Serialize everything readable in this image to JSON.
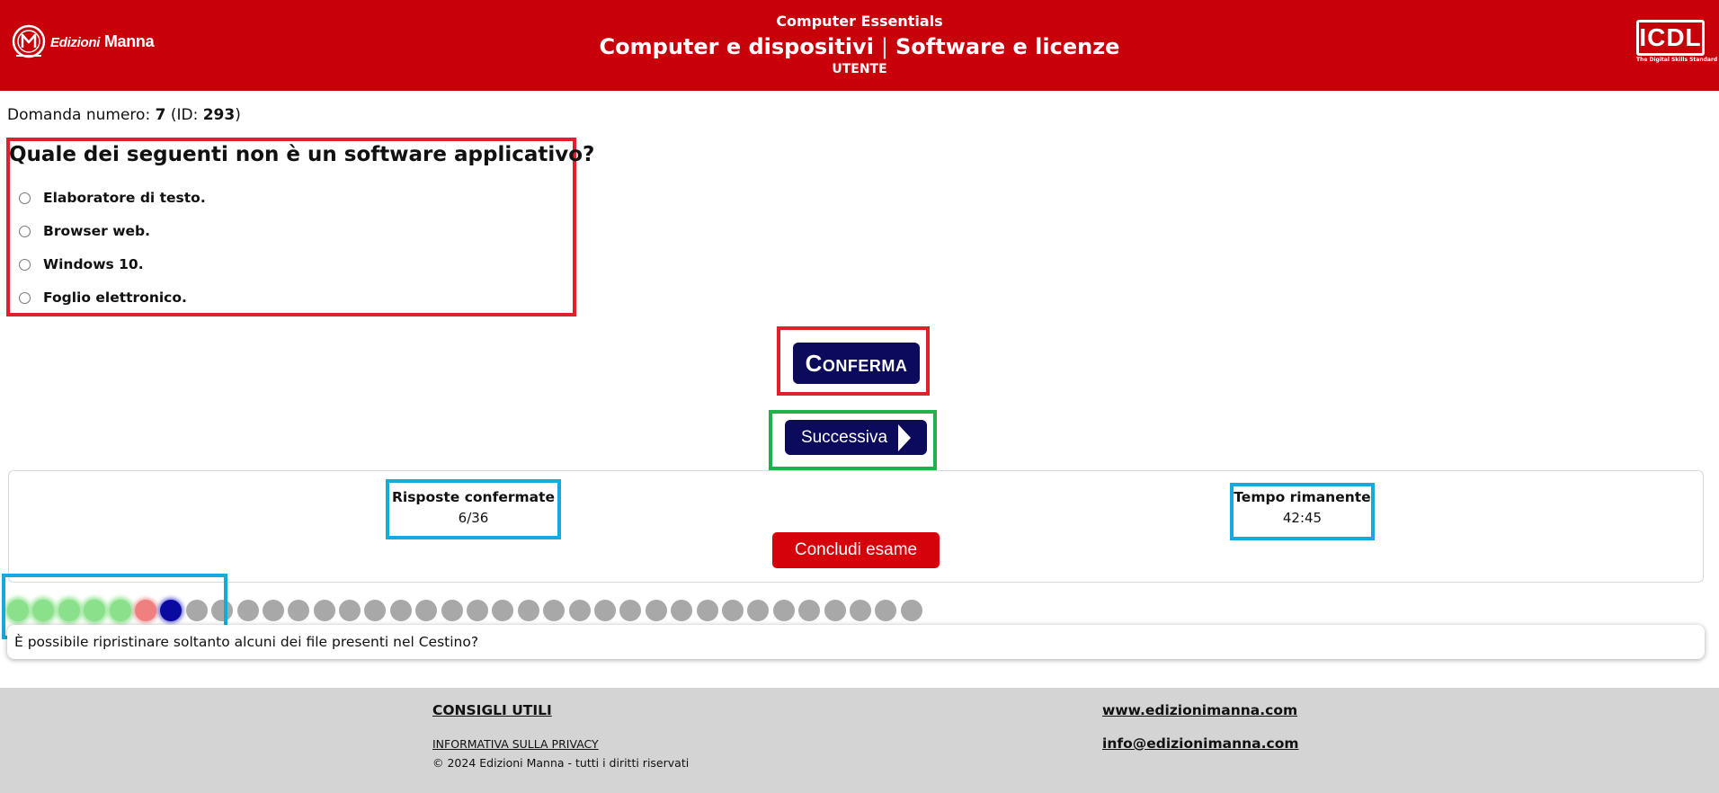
{
  "header": {
    "logo_text_italic": "Edizioni",
    "logo_text_bold": "Manna",
    "course": "Computer Essentials",
    "title_part1": "Computer e dispositivi",
    "title_separator": "|",
    "title_part2": "Software e licenze",
    "level": "UTENTE",
    "badge_text": "ICDL",
    "badge_subtext": "The Digital Skills Standard"
  },
  "question": {
    "number_label": "Domanda numero:",
    "number": "7",
    "id_open": "(ID:",
    "id": "293",
    "id_close": ")",
    "text": "Quale dei seguenti non è un software applicativo?",
    "options": [
      "Elaboratore di testo.",
      "Browser web.",
      "Windows 10.",
      "Foglio elettronico."
    ]
  },
  "buttons": {
    "confirm": "Conferma",
    "next": "Successiva",
    "end_exam": "Concludi esame"
  },
  "status": {
    "confirmed_label": "Risposte confermate",
    "confirmed_value": "6/36",
    "time_label": "Tempo rimanente",
    "time_value": "42:45"
  },
  "progress": {
    "total": 36,
    "states": [
      "correct",
      "correct",
      "correct",
      "correct",
      "correct",
      "wrong",
      "current",
      "pending",
      "pending",
      "pending",
      "pending",
      "pending",
      "pending",
      "pending",
      "pending",
      "pending",
      "pending",
      "pending",
      "pending",
      "pending",
      "pending",
      "pending",
      "pending",
      "pending",
      "pending",
      "pending",
      "pending",
      "pending",
      "pending",
      "pending",
      "pending",
      "pending",
      "pending",
      "pending",
      "pending",
      "pending"
    ],
    "colors": {
      "correct": "#8be08b",
      "wrong": "#f08080",
      "current": "#0a0aa0",
      "pending": "#a8a8a8"
    }
  },
  "hover_preview": "È possibile ripristinare soltanto alcuni dei file presenti nel Cestino?",
  "footer": {
    "tips": "CONSIGLI UTILI",
    "privacy": "INFORMATIVA SULLA PRIVACY",
    "copyright": "© 2024 Edizioni Manna - tutti i diritti riservati",
    "website": "www.edizionimanna.com",
    "email": "info@edizionimanna.com"
  },
  "colors": {
    "header_red": "#c8000a",
    "navy": "#0c0a5a",
    "end_red": "#d5020b",
    "annotation_red": "#e0202a",
    "annotation_green": "#1fb24a",
    "annotation_blue": "#18a8e0"
  }
}
